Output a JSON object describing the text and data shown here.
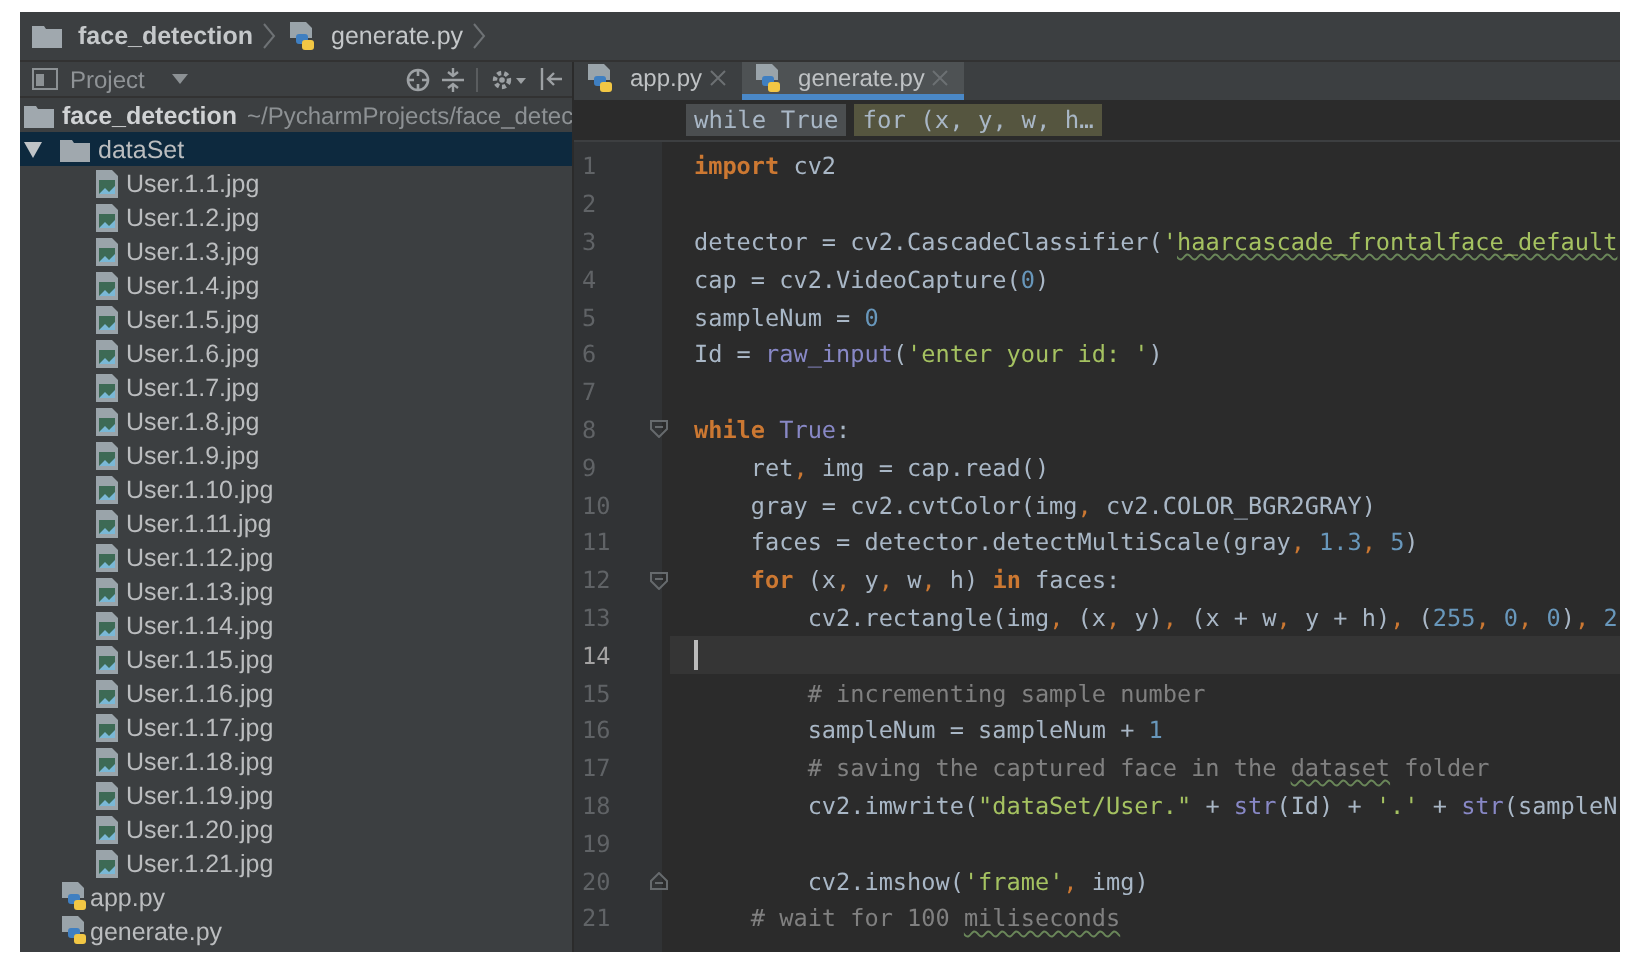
{
  "navigation_bar": {
    "crumbs": [
      {
        "label": "face_detection",
        "kind": "folder"
      },
      {
        "label": "generate.py",
        "kind": "python"
      }
    ]
  },
  "project_panel": {
    "title": "Project",
    "tree": [
      {
        "label": "face_detection",
        "path": "~/PycharmProjects/face_detec",
        "kind": "folder",
        "selected": false,
        "children": [
          {
            "label": "dataSet",
            "kind": "folder",
            "expanded": true,
            "selected": true,
            "children": [
              {
                "label": "User.1.1.jpg",
                "kind": "image",
                "selected": false
              },
              {
                "label": "User.1.2.jpg",
                "kind": "image",
                "selected": false
              },
              {
                "label": "User.1.3.jpg",
                "kind": "image",
                "selected": false
              },
              {
                "label": "User.1.4.jpg",
                "kind": "image",
                "selected": false
              },
              {
                "label": "User.1.5.jpg",
                "kind": "image",
                "selected": false
              },
              {
                "label": "User.1.6.jpg",
                "kind": "image",
                "selected": false
              },
              {
                "label": "User.1.7.jpg",
                "kind": "image",
                "selected": false
              },
              {
                "label": "User.1.8.jpg",
                "kind": "image",
                "selected": false
              },
              {
                "label": "User.1.9.jpg",
                "kind": "image",
                "selected": false
              },
              {
                "label": "User.1.10.jpg",
                "kind": "image",
                "selected": false
              },
              {
                "label": "User.1.11.jpg",
                "kind": "image",
                "selected": false
              },
              {
                "label": "User.1.12.jpg",
                "kind": "image",
                "selected": false
              },
              {
                "label": "User.1.13.jpg",
                "kind": "image",
                "selected": false
              },
              {
                "label": "User.1.14.jpg",
                "kind": "image",
                "selected": false
              },
              {
                "label": "User.1.15.jpg",
                "kind": "image",
                "selected": false
              },
              {
                "label": "User.1.16.jpg",
                "kind": "image",
                "selected": false
              },
              {
                "label": "User.1.17.jpg",
                "kind": "image",
                "selected": false
              },
              {
                "label": "User.1.18.jpg",
                "kind": "image",
                "selected": false
              },
              {
                "label": "User.1.19.jpg",
                "kind": "image",
                "selected": false
              },
              {
                "label": "User.1.20.jpg",
                "kind": "image",
                "selected": false
              },
              {
                "label": "User.1.21.jpg",
                "kind": "image",
                "selected": false
              }
            ]
          },
          {
            "label": "app.py",
            "kind": "python",
            "selected": false
          },
          {
            "label": "generate.py",
            "kind": "python",
            "selected": false
          }
        ]
      }
    ]
  },
  "editor": {
    "tabs": [
      {
        "label": "app.py",
        "selected": false
      },
      {
        "label": "generate.py",
        "selected": true
      }
    ],
    "scope_crumbs": [
      {
        "label": "while True",
        "selected": false
      },
      {
        "label": "for (x, y, w, h…",
        "selected": true
      }
    ],
    "lines": [
      {
        "number": "1",
        "current": false,
        "fold_start": false,
        "fold_end": false,
        "tokens": [
          {
            "kind": "keyword",
            "text": "import"
          },
          {
            "kind": "plain",
            "text": " cv2"
          }
        ]
      },
      {
        "number": "2",
        "current": false,
        "fold_start": false,
        "fold_end": false
      },
      {
        "number": "3",
        "current": false,
        "fold_start": false,
        "fold_end": false,
        "tokens": [
          {
            "kind": "plain",
            "text": "detector = cv2.CascadeClassifier("
          },
          {
            "kind": "string",
            "text": "'"
          },
          {
            "kind": "string",
            "text": "haarcascade_frontalface_default",
            "spell": true
          }
        ]
      },
      {
        "number": "4",
        "current": false,
        "fold_start": false,
        "fold_end": false,
        "tokens": [
          {
            "kind": "plain",
            "text": "cap = cv2.VideoCapture("
          },
          {
            "kind": "number",
            "text": "0"
          },
          {
            "kind": "plain",
            "text": ")"
          }
        ]
      },
      {
        "number": "5",
        "current": false,
        "fold_start": false,
        "fold_end": false,
        "tokens": [
          {
            "kind": "plain",
            "text": "sampleNum = "
          },
          {
            "kind": "number",
            "text": "0"
          }
        ]
      },
      {
        "number": "6",
        "current": false,
        "fold_start": false,
        "fold_end": false,
        "tokens": [
          {
            "kind": "plain",
            "text": "Id = "
          },
          {
            "kind": "builtin",
            "text": "raw_input"
          },
          {
            "kind": "plain",
            "text": "("
          },
          {
            "kind": "string",
            "text": "'enter your id: '"
          },
          {
            "kind": "plain",
            "text": ")"
          }
        ]
      },
      {
        "number": "7",
        "current": false,
        "fold_start": false,
        "fold_end": false
      },
      {
        "number": "8",
        "current": false,
        "fold_start": true,
        "fold_end": false,
        "tokens": [
          {
            "kind": "keyword",
            "text": "while"
          },
          {
            "kind": "builtin",
            "text": " True"
          },
          {
            "kind": "plain",
            "text": ":"
          }
        ]
      },
      {
        "number": "9",
        "current": false,
        "fold_start": false,
        "fold_end": false,
        "tokens": [
          {
            "kind": "plain",
            "text": "    ret"
          },
          {
            "kind": "punct",
            "text": ","
          },
          {
            "kind": "plain",
            "text": " img = cap.read()"
          }
        ]
      },
      {
        "number": "10",
        "current": false,
        "fold_start": false,
        "fold_end": false,
        "tokens": [
          {
            "kind": "plain",
            "text": "    gray = cv2.cvtColor(img"
          },
          {
            "kind": "punct",
            "text": ","
          },
          {
            "kind": "plain",
            "text": " cv2.COLOR_BGR2GRAY)"
          }
        ]
      },
      {
        "number": "11",
        "current": false,
        "fold_start": false,
        "fold_end": false,
        "tokens": [
          {
            "kind": "plain",
            "text": "    faces = detector.detectMultiScale(gray"
          },
          {
            "kind": "punct",
            "text": ", "
          },
          {
            "kind": "number",
            "text": "1.3"
          },
          {
            "kind": "punct",
            "text": ", "
          },
          {
            "kind": "number",
            "text": "5"
          },
          {
            "kind": "plain",
            "text": ")"
          }
        ]
      },
      {
        "number": "12",
        "current": false,
        "fold_start": true,
        "fold_end": false,
        "tokens": [
          {
            "kind": "keyword",
            "text": "    for"
          },
          {
            "kind": "plain",
            "text": " (x"
          },
          {
            "kind": "punct",
            "text": ","
          },
          {
            "kind": "plain",
            "text": " y"
          },
          {
            "kind": "punct",
            "text": ","
          },
          {
            "kind": "plain",
            "text": " w"
          },
          {
            "kind": "punct",
            "text": ","
          },
          {
            "kind": "plain",
            "text": " h) "
          },
          {
            "kind": "keyword",
            "text": "in"
          },
          {
            "kind": "plain",
            "text": " faces:"
          }
        ]
      },
      {
        "number": "13",
        "current": false,
        "fold_start": false,
        "fold_end": false,
        "tokens": [
          {
            "kind": "plain",
            "text": "        cv2.rectangle(img"
          },
          {
            "kind": "punct",
            "text": ","
          },
          {
            "kind": "plain",
            "text": " (x"
          },
          {
            "kind": "punct",
            "text": ","
          },
          {
            "kind": "plain",
            "text": " y)"
          },
          {
            "kind": "punct",
            "text": ","
          },
          {
            "kind": "plain",
            "text": " (x + w"
          },
          {
            "kind": "punct",
            "text": ","
          },
          {
            "kind": "plain",
            "text": " y + h)"
          },
          {
            "kind": "punct",
            "text": ","
          },
          {
            "kind": "plain",
            "text": " ("
          },
          {
            "kind": "number",
            "text": "255"
          },
          {
            "kind": "punct",
            "text": ", "
          },
          {
            "kind": "number",
            "text": "0"
          },
          {
            "kind": "punct",
            "text": ", "
          },
          {
            "kind": "number",
            "text": "0"
          },
          {
            "kind": "plain",
            "text": ")"
          },
          {
            "kind": "punct",
            "text": ", "
          },
          {
            "kind": "number",
            "text": "2"
          }
        ]
      },
      {
        "number": "14",
        "current": true,
        "fold_start": false,
        "fold_end": false
      },
      {
        "number": "15",
        "current": false,
        "fold_start": false,
        "fold_end": false,
        "tokens": [
          {
            "kind": "comment",
            "text": "        # incrementing sample number"
          }
        ]
      },
      {
        "number": "16",
        "current": false,
        "fold_start": false,
        "fold_end": false,
        "tokens": [
          {
            "kind": "plain",
            "text": "        sampleNum = sampleNum + "
          },
          {
            "kind": "number",
            "text": "1"
          }
        ]
      },
      {
        "number": "17",
        "current": false,
        "fold_start": false,
        "fold_end": false,
        "tokens": [
          {
            "kind": "comment",
            "text": "        # saving the captured face in the "
          },
          {
            "kind": "comment",
            "text": "dataset",
            "spell": true
          },
          {
            "kind": "comment",
            "text": " folder"
          }
        ]
      },
      {
        "number": "18",
        "current": false,
        "fold_start": false,
        "fold_end": false,
        "tokens": [
          {
            "kind": "plain",
            "text": "        cv2.imwrite("
          },
          {
            "kind": "string",
            "text": "\"dataSet/User.\""
          },
          {
            "kind": "plain",
            "text": " + "
          },
          {
            "kind": "builtin",
            "text": "str"
          },
          {
            "kind": "plain",
            "text": "(Id) + "
          },
          {
            "kind": "string",
            "text": "'.'"
          },
          {
            "kind": "plain",
            "text": " + "
          },
          {
            "kind": "builtin",
            "text": "str"
          },
          {
            "kind": "plain",
            "text": "(sampleN"
          }
        ]
      },
      {
        "number": "19",
        "current": false,
        "fold_start": false,
        "fold_end": false
      },
      {
        "number": "20",
        "current": false,
        "fold_start": false,
        "fold_end": true,
        "tokens": [
          {
            "kind": "plain",
            "text": "        cv2.imshow("
          },
          {
            "kind": "string",
            "text": "'frame'"
          },
          {
            "kind": "punct",
            "text": ","
          },
          {
            "kind": "plain",
            "text": " img)"
          }
        ]
      },
      {
        "number": "21",
        "current": false,
        "fold_start": false,
        "fold_end": false,
        "tokens": [
          {
            "kind": "comment",
            "text": "    # wait for 100 "
          },
          {
            "kind": "comment",
            "text": "miliseconds",
            "spell": true
          }
        ]
      }
    ]
  }
}
